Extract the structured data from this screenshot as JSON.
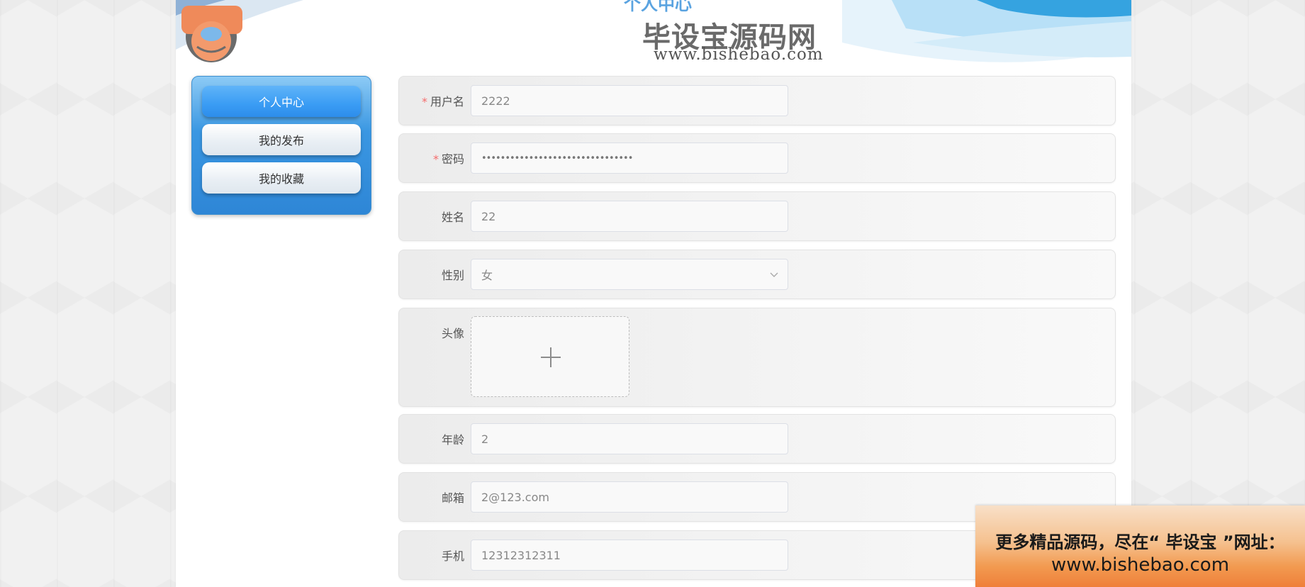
{
  "header": {
    "title": "个人中心",
    "logo_badge": "毕设宝",
    "logo_name": "毕设宝源码网",
    "logo_url": "www.bishebao.com"
  },
  "sidebar": {
    "items": [
      {
        "label": "个人中心",
        "active": true
      },
      {
        "label": "我的发布",
        "active": false
      },
      {
        "label": "我的收藏",
        "active": false
      }
    ]
  },
  "form": {
    "username": {
      "label": "用户名",
      "required": "*",
      "value": "2222"
    },
    "password": {
      "label": "密码",
      "required": "*",
      "value": "••••••••••••••••••••••••••••••••"
    },
    "name": {
      "label": "姓名",
      "value": "22"
    },
    "gender": {
      "label": "性别",
      "value": "女"
    },
    "avatar": {
      "label": "头像"
    },
    "age": {
      "label": "年龄",
      "value": "2"
    },
    "email": {
      "label": "邮箱",
      "value": "2@123.com"
    },
    "phone": {
      "label": "手机",
      "value": "12312312311"
    }
  },
  "promo": {
    "line1": "更多精品源码，尽在“ 毕设宝 ”网址：",
    "line2": "www.bishebao.com"
  },
  "colors": {
    "accent": "#3a9cf4",
    "sidebar": "#2e86d6",
    "required": "#f56c6c",
    "promo": "#f29a50"
  }
}
